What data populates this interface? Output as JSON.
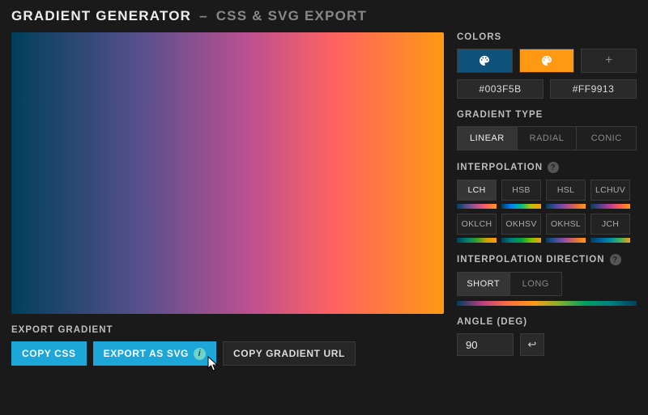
{
  "header": {
    "title": "GRADIENT GENERATOR",
    "separator": "–",
    "subtitle": "CSS & SVG EXPORT"
  },
  "export": {
    "label": "EXPORT GRADIENT",
    "copy_css": "COPY CSS",
    "export_svg": "EXPORT AS SVG",
    "copy_url": "COPY GRADIENT URL"
  },
  "colors_panel": {
    "label": "COLORS",
    "add_symbol": "+",
    "hex1": "#003F5B",
    "hex2": "#FF9913"
  },
  "gradient_type": {
    "label": "GRADIENT TYPE",
    "options": [
      "LINEAR",
      "RADIAL",
      "CONIC"
    ],
    "active": "LINEAR"
  },
  "interpolation": {
    "label": "INTERPOLATION",
    "options": [
      "LCH",
      "HSB",
      "HSL",
      "LCHUV",
      "OKLCH",
      "OKHSV",
      "OKHSL",
      "JCH"
    ],
    "active": "LCH"
  },
  "interp_direction": {
    "label": "INTERPOLATION DIRECTION",
    "options": [
      "SHORT",
      "LONG"
    ],
    "active": "SHORT"
  },
  "angle": {
    "label": "ANGLE (DEG)",
    "value": "90"
  },
  "icons": {
    "info_glyph": "?",
    "info_badge_glyph": "i",
    "reverse_glyph": "↩"
  }
}
